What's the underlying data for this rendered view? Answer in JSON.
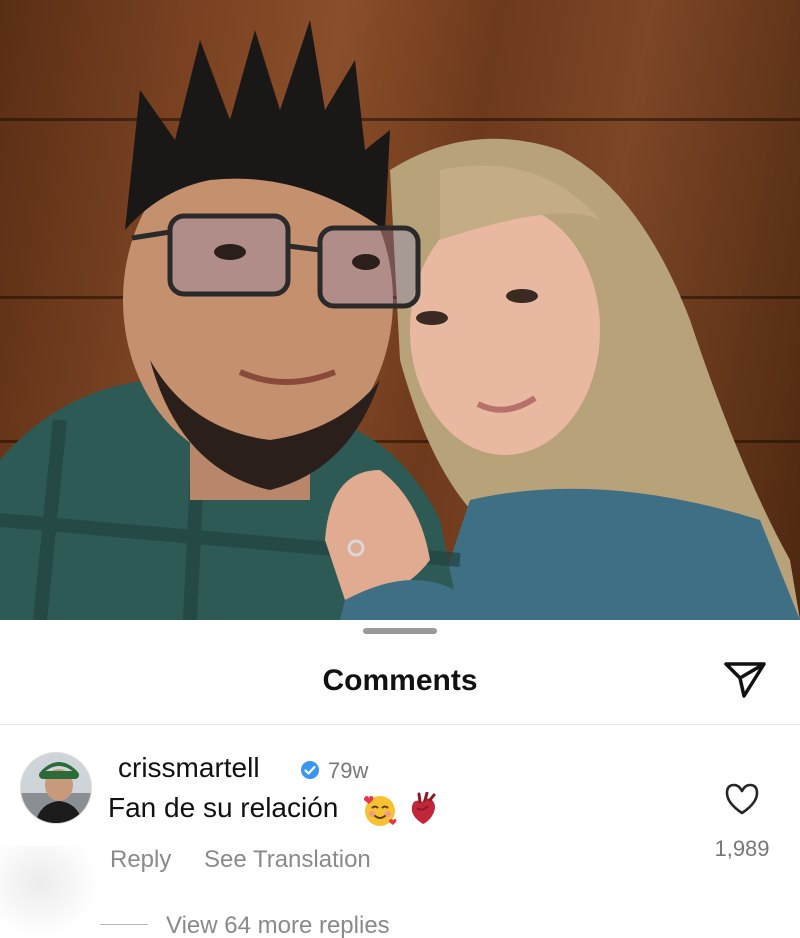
{
  "sheet": {
    "title": "Comments"
  },
  "comment": {
    "username": "crissmartell",
    "time": "79w",
    "text": "Fan de su relación",
    "emojis": [
      "smiling-face-with-hearts-emoji",
      "anatomical-heart-emoji"
    ],
    "reply_label": "Reply",
    "translate_label": "See Translation",
    "like_count": "1,989",
    "view_replies_label": "View 64 more replies"
  },
  "colors": {
    "verified": "#3897f0",
    "secondary_text": "#8a8a8a",
    "sheet_background": "#ffffff"
  }
}
